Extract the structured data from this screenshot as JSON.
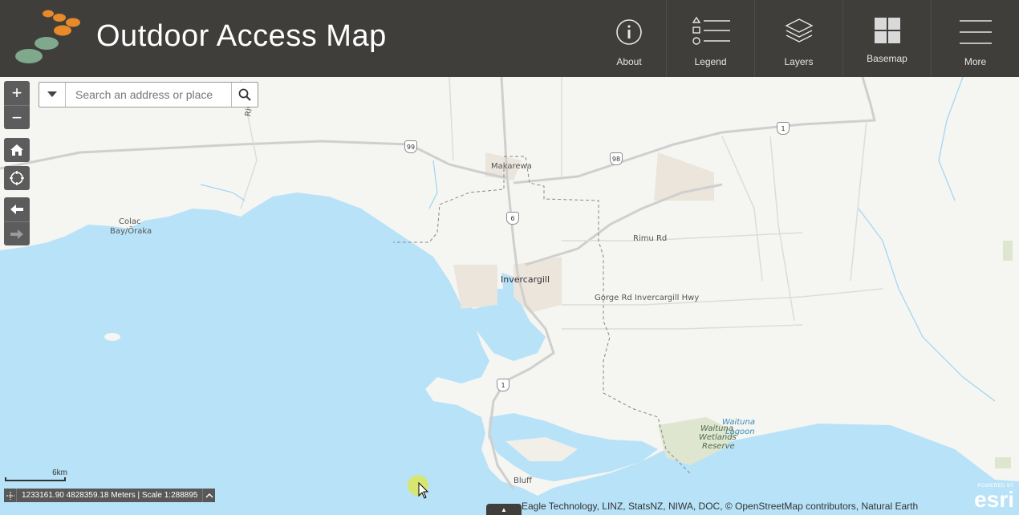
{
  "app": {
    "title": "Outdoor Access Map"
  },
  "toolbar": {
    "about": {
      "label": "About",
      "icon": "info-icon"
    },
    "legend": {
      "label": "Legend",
      "icon": "legend-icon"
    },
    "layers": {
      "label": "Layers",
      "icon": "layers-icon"
    },
    "basemap": {
      "label": "Basemap",
      "icon": "basemap-grid-icon"
    },
    "more": {
      "label": "More",
      "icon": "hamburger-menu-icon"
    }
  },
  "search": {
    "placeholder": "Search an address or place"
  },
  "controls": {
    "zoom_in": "+",
    "zoom_out": "−",
    "home_icon": "home-icon",
    "locate_icon": "locate-icon",
    "back_icon": "arrow-left-icon",
    "forward_icon": "arrow-right-icon"
  },
  "map_labels": {
    "makarewa": "Makarewa",
    "colac_1": "Colac",
    "colac_2": "Bay/Ōraka",
    "invercargill": "Invercargill",
    "rimu_rd": "Rimu Rd",
    "gorge_rd": "Gorge Rd Invercargill Hwy",
    "bluff": "Bluff",
    "waituna_1": "Waituna",
    "waituna_2": "Lagoon",
    "wetlands_1": "Waituna",
    "wetlands_2": "Wetlands",
    "wetlands_3": "Reserve",
    "river": "Riv"
  },
  "shields": {
    "s99": "99",
    "s98": "98",
    "s6": "6",
    "s1_north": "1",
    "s1_south": "1"
  },
  "scale": {
    "label": "6km"
  },
  "coords": {
    "text": "1233161.90 4828359.18 Meters | Scale 1:288895"
  },
  "attribution": "Eagle Technology, LINZ, StatsNZ, NIWA, DOC, © OpenStreetMap contributors, Natural Earth",
  "esri": {
    "powered": "POWERED BY",
    "brand": "esri"
  },
  "colors": {
    "header": "#3f3e3b",
    "water": "#b8e2f8",
    "land": "#f5f5f2",
    "road": "#c8c8c8"
  }
}
